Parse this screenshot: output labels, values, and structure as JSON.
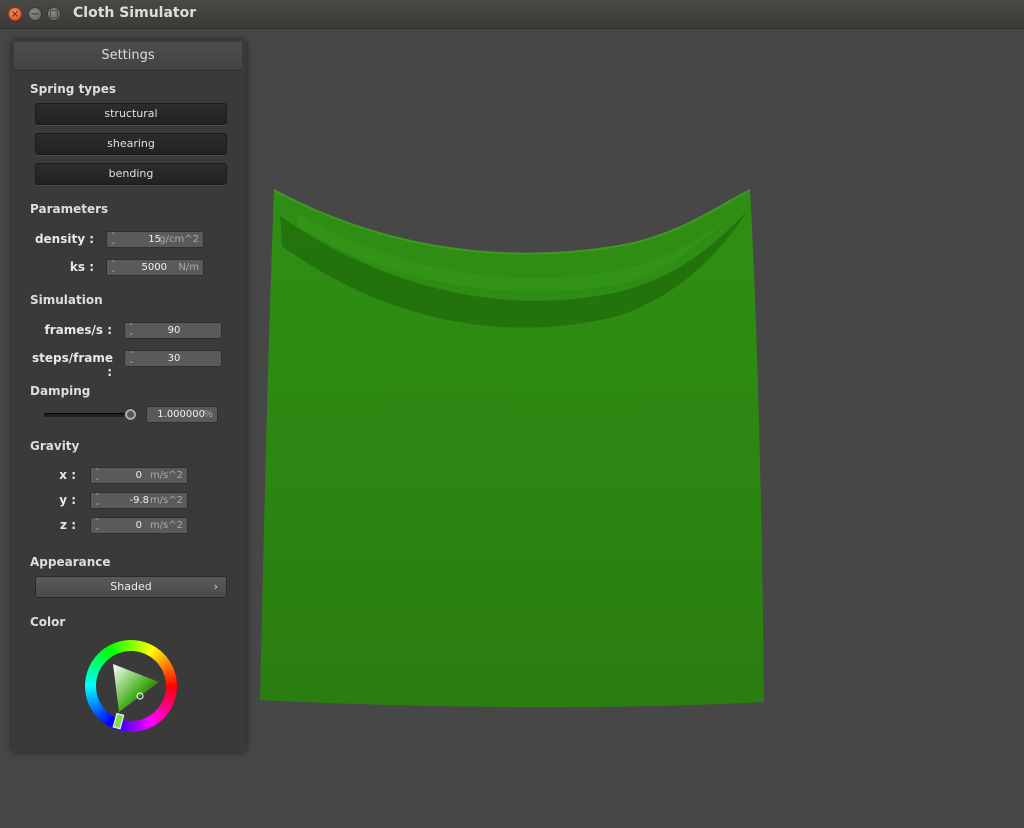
{
  "window": {
    "title": "Cloth Simulator",
    "close_glyph": "×",
    "min_glyph": "−",
    "max_glyph": "□"
  },
  "panel": {
    "title": "Settings",
    "spring_types": {
      "heading": "Spring types",
      "buttons": [
        "structural",
        "shearing",
        "bending"
      ]
    },
    "parameters": {
      "heading": "Parameters",
      "density": {
        "label": "density :",
        "value": "15",
        "unit": "g/cm^2"
      },
      "ks": {
        "label": "ks :",
        "value": "5000",
        "unit": "N/m"
      }
    },
    "simulation": {
      "heading": "Simulation",
      "frames": {
        "label": "frames/s :",
        "value": "90"
      },
      "steps": {
        "label": "steps/frame :",
        "value": "30"
      }
    },
    "damping": {
      "heading": "Damping",
      "value": "1.000000",
      "unit": "%",
      "slider_level": 0.98
    },
    "gravity": {
      "heading": "Gravity",
      "x": {
        "label": "x :",
        "value": "0",
        "unit": "m/s^2"
      },
      "y": {
        "label": "y :",
        "value": "-9.8",
        "unit": "m/s^2"
      },
      "z": {
        "label": "z :",
        "value": "0",
        "unit": "m/s^2"
      }
    },
    "appearance": {
      "heading": "Appearance",
      "selected": "Shaded",
      "chevron": "›"
    },
    "color": {
      "heading": "Color",
      "selected_hex": "#2e8b12"
    }
  },
  "colors": {
    "background": "#474747",
    "panel": "#3a3a3a",
    "cloth": "#2e8b12"
  }
}
